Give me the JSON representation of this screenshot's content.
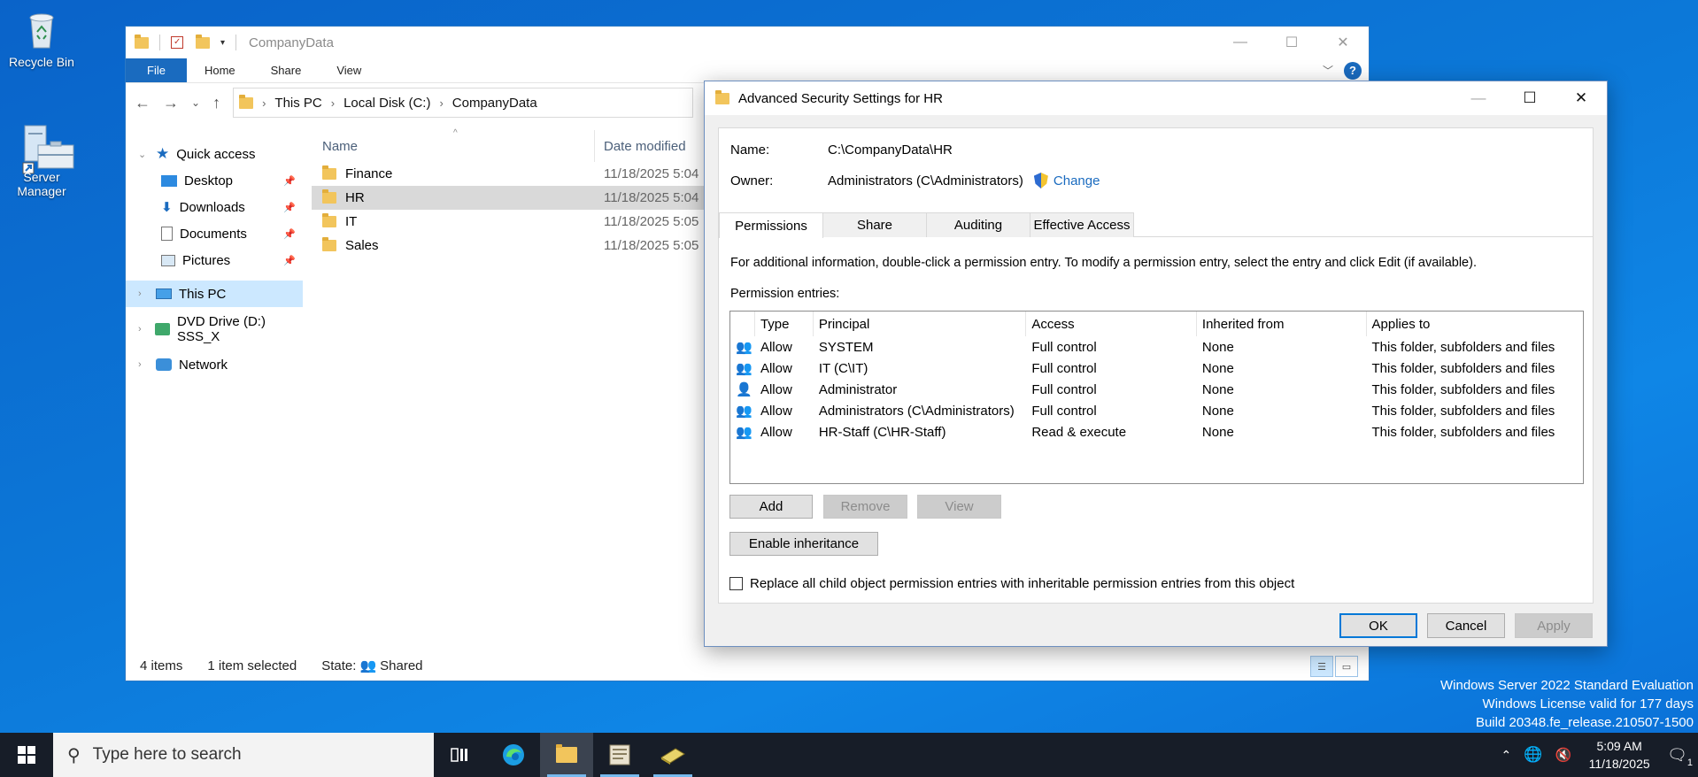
{
  "desktop": {
    "icons": [
      {
        "label": "Recycle Bin",
        "icon": "recycle-bin-icon"
      },
      {
        "label": "Server\nManager",
        "label_line1": "Server",
        "label_line2": "Manager",
        "icon": "server-manager-icon"
      }
    ],
    "watermark": {
      "line1": "Windows Server 2022 Standard Evaluation",
      "line2": "Windows License valid for 177 days",
      "line3": "Build 20348.fe_release.210507-1500"
    }
  },
  "explorer": {
    "title": "CompanyData",
    "ribbon_tabs": [
      "File",
      "Home",
      "Share",
      "View"
    ],
    "breadcrumb": [
      "This PC",
      "Local Disk (C:)",
      "CompanyData"
    ],
    "nav": {
      "quick_access": "Quick access",
      "pinned": [
        "Desktop",
        "Downloads",
        "Documents",
        "Pictures"
      ],
      "this_pc": "This PC",
      "dvd": "DVD Drive (D:) SSS_X",
      "network": "Network"
    },
    "columns": {
      "name": "Name",
      "date": "Date modified"
    },
    "files": [
      {
        "name": "Finance",
        "date": "11/18/2025 5:04"
      },
      {
        "name": "HR",
        "date": "11/18/2025 5:04"
      },
      {
        "name": "IT",
        "date": "11/18/2025 5:05"
      },
      {
        "name": "Sales",
        "date": "11/18/2025 5:05"
      }
    ],
    "status": {
      "count": "4 items",
      "selected": "1 item selected",
      "state_label": "State:",
      "state_value": "Shared"
    }
  },
  "dialog": {
    "title": "Advanced Security Settings for HR",
    "name_label": "Name:",
    "name_value": "C:\\CompanyData\\HR",
    "owner_label": "Owner:",
    "owner_value": "Administrators (C\\Administrators)",
    "change_label": "Change",
    "tabs": [
      "Permissions",
      "Share",
      "Auditing",
      "Effective Access"
    ],
    "info": "For additional information, double-click a permission entry. To modify a permission entry, select the entry and click Edit (if available).",
    "entries_label": "Permission entries:",
    "columns": [
      "Type",
      "Principal",
      "Access",
      "Inherited from",
      "Applies to"
    ],
    "entries": [
      {
        "type": "Allow",
        "principal": "SYSTEM",
        "access": "Full control",
        "inherited": "None",
        "applies": "This folder, subfolders and files",
        "icon": "group-icon"
      },
      {
        "type": "Allow",
        "principal": "IT (C\\IT)",
        "access": "Full control",
        "inherited": "None",
        "applies": "This folder, subfolders and files",
        "icon": "group-icon"
      },
      {
        "type": "Allow",
        "principal": "Administrator",
        "access": "Full control",
        "inherited": "None",
        "applies": "This folder, subfolders and files",
        "icon": "user-icon"
      },
      {
        "type": "Allow",
        "principal": "Administrators (C\\Administrators)",
        "access": "Full control",
        "inherited": "None",
        "applies": "This folder, subfolders and files",
        "icon": "group-icon"
      },
      {
        "type": "Allow",
        "principal": "HR-Staff (C\\HR-Staff)",
        "access": "Read & execute",
        "inherited": "None",
        "applies": "This folder, subfolders and files",
        "icon": "group-icon"
      }
    ],
    "buttons": {
      "add": "Add",
      "remove": "Remove",
      "view": "View",
      "enable_inheritance": "Enable inheritance",
      "ok": "OK",
      "cancel": "Cancel",
      "apply": "Apply"
    },
    "replace_checkbox": "Replace all child object permission entries with inheritable permission entries from this object"
  },
  "taskbar": {
    "search_placeholder": "Type here to search",
    "time": "5:09 AM",
    "date": "11/18/2025",
    "notification_count": "1"
  },
  "colors": {
    "accent": "#0078d7",
    "taskbar": "#171d28",
    "desktop": "#0c78d8"
  }
}
